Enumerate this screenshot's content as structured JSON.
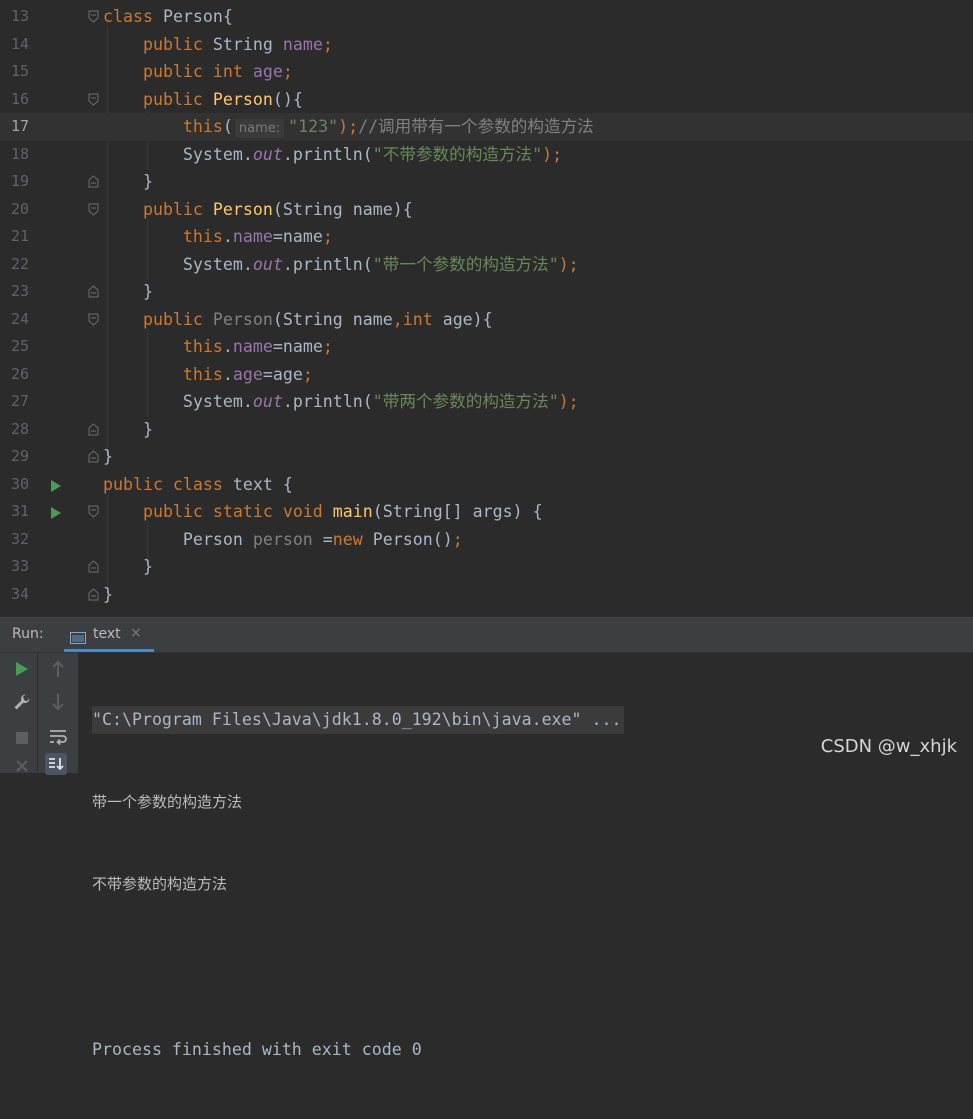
{
  "editor": {
    "current_line": 17,
    "lines": [
      {
        "n": "13",
        "parts": [
          {
            "t": "class ",
            "c": "kw"
          },
          {
            "t": "Person{",
            "c": ""
          }
        ]
      },
      {
        "n": "14",
        "parts": [
          {
            "t": "    public ",
            "c": "kw"
          },
          {
            "t": "String ",
            "c": ""
          },
          {
            "t": "name",
            "c": "fld"
          },
          {
            "t": ";",
            "c": "kw"
          }
        ]
      },
      {
        "n": "15",
        "parts": [
          {
            "t": "    public int ",
            "c": "kw"
          },
          {
            "t": "age",
            "c": "fld"
          },
          {
            "t": ";",
            "c": "kw"
          }
        ]
      },
      {
        "n": "16",
        "parts": [
          {
            "t": "    public ",
            "c": "kw"
          },
          {
            "t": "Person",
            "c": "fn"
          },
          {
            "t": "(){",
            "c": ""
          }
        ]
      },
      {
        "n": "17",
        "parts": [
          {
            "t": "        this",
            "c": "kw"
          },
          {
            "t": "(",
            "c": ""
          },
          {
            "hint": "name:"
          },
          {
            "t": "\"123\"",
            "c": "str"
          },
          {
            "t": ");",
            "c": "kw"
          },
          {
            "t": "//调用带有一个参数的构造方法",
            "c": "cmt"
          }
        ]
      },
      {
        "n": "18",
        "parts": [
          {
            "t": "        System.",
            "c": ""
          },
          {
            "t": "out",
            "c": "st"
          },
          {
            "t": ".println(",
            "c": ""
          },
          {
            "t": "\"不带参数的构造方法\"",
            "c": "str"
          },
          {
            "t": ");",
            "c": "kw"
          }
        ]
      },
      {
        "n": "19",
        "parts": [
          {
            "t": "    }",
            "c": ""
          }
        ]
      },
      {
        "n": "20",
        "parts": [
          {
            "t": "    public ",
            "c": "kw"
          },
          {
            "t": "Person",
            "c": "fn"
          },
          {
            "t": "(String name){",
            "c": ""
          }
        ]
      },
      {
        "n": "21",
        "parts": [
          {
            "t": "        this",
            "c": "kw"
          },
          {
            "t": ".",
            "c": ""
          },
          {
            "t": "name",
            "c": "fld"
          },
          {
            "t": "=name",
            "c": ""
          },
          {
            "t": ";",
            "c": "kw"
          }
        ]
      },
      {
        "n": "22",
        "parts": [
          {
            "t": "        System.",
            "c": ""
          },
          {
            "t": "out",
            "c": "st"
          },
          {
            "t": ".println(",
            "c": ""
          },
          {
            "t": "\"带一个参数的构造方法\"",
            "c": "str"
          },
          {
            "t": ");",
            "c": "kw"
          }
        ]
      },
      {
        "n": "23",
        "parts": [
          {
            "t": "    }",
            "c": ""
          }
        ]
      },
      {
        "n": "24",
        "parts": [
          {
            "t": "    public ",
            "c": "kw"
          },
          {
            "t": "Person",
            "c": "unused"
          },
          {
            "t": "(String name",
            "c": ""
          },
          {
            "t": ",int ",
            "c": "kw"
          },
          {
            "t": "age){",
            "c": ""
          }
        ]
      },
      {
        "n": "25",
        "parts": [
          {
            "t": "        this",
            "c": "kw"
          },
          {
            "t": ".",
            "c": ""
          },
          {
            "t": "name",
            "c": "fld"
          },
          {
            "t": "=name",
            "c": ""
          },
          {
            "t": ";",
            "c": "kw"
          }
        ]
      },
      {
        "n": "26",
        "parts": [
          {
            "t": "        this",
            "c": "kw"
          },
          {
            "t": ".",
            "c": ""
          },
          {
            "t": "age",
            "c": "fld"
          },
          {
            "t": "=age",
            "c": ""
          },
          {
            "t": ";",
            "c": "kw"
          }
        ]
      },
      {
        "n": "27",
        "parts": [
          {
            "t": "        System.",
            "c": ""
          },
          {
            "t": "out",
            "c": "st"
          },
          {
            "t": ".println(",
            "c": ""
          },
          {
            "t": "\"带两个参数的构造方法\"",
            "c": "str"
          },
          {
            "t": ");",
            "c": "kw"
          }
        ]
      },
      {
        "n": "28",
        "parts": [
          {
            "t": "    }",
            "c": ""
          }
        ]
      },
      {
        "n": "29",
        "parts": [
          {
            "t": "}",
            "c": ""
          }
        ]
      },
      {
        "n": "30",
        "parts": [
          {
            "t": "public class ",
            "c": "kw"
          },
          {
            "t": "text {",
            "c": ""
          }
        ]
      },
      {
        "n": "31",
        "parts": [
          {
            "t": "    public static void ",
            "c": "kw"
          },
          {
            "t": "main",
            "c": "fn"
          },
          {
            "t": "(String[] args) {",
            "c": ""
          }
        ]
      },
      {
        "n": "32",
        "parts": [
          {
            "t": "        Person ",
            "c": ""
          },
          {
            "t": "person ",
            "c": "unused"
          },
          {
            "t": "=",
            "c": ""
          },
          {
            "t": "new ",
            "c": "kw"
          },
          {
            "t": "Person()",
            "c": ""
          },
          {
            "t": ";",
            "c": "kw"
          }
        ]
      },
      {
        "n": "33",
        "parts": [
          {
            "t": "    }",
            "c": ""
          }
        ]
      },
      {
        "n": "34",
        "parts": [
          {
            "t": "}",
            "c": ""
          }
        ]
      }
    ]
  },
  "run_panel": {
    "label": "Run:",
    "tab_label": "text",
    "tab_close": "×",
    "console": {
      "command": "\"C:\\Program Files\\Java\\jdk1.8.0_192\\bin\\java.exe\" ...",
      "output_line_1": "带一个参数的构造方法",
      "output_line_2": "不带参数的构造方法",
      "exit_line": "Process finished with exit code 0"
    }
  },
  "watermark": "CSDN @w_xhjk",
  "colors": {
    "background": "#2b2b2b",
    "keyword": "#cc7832",
    "string": "#6a8759",
    "field": "#9876aa",
    "method": "#ffc66d",
    "comment": "#808080",
    "run_green": "#499c54"
  }
}
